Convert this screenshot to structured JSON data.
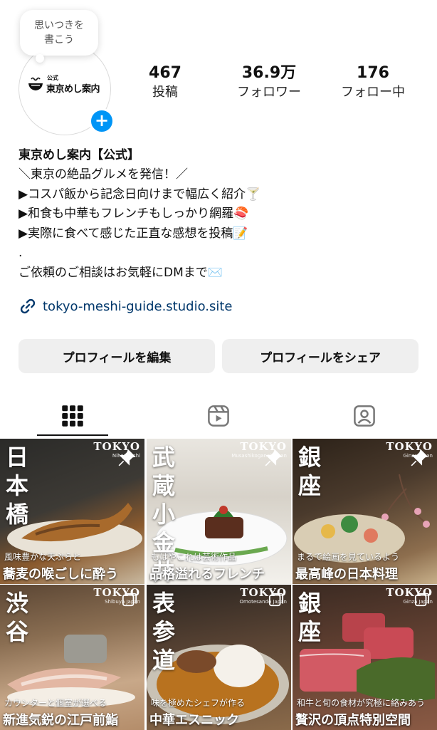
{
  "note": {
    "text": "思いつきを\n書こう"
  },
  "avatar": {
    "logo_small": "公式",
    "logo_name": "東京めし案内"
  },
  "stats": [
    {
      "num": "467",
      "label": "投稿"
    },
    {
      "num": "36.9万",
      "label": "フォロワー"
    },
    {
      "num": "176",
      "label": "フォロー中"
    }
  ],
  "bio": {
    "name": "東京めし案内【公式】",
    "lines": [
      "＼東京の絶品グルメを発信！／",
      "▶コスパ飯から記念日向けまで幅広く紹介🍸",
      "▶和食も中華もフレンチもしっかり網羅🍣",
      "▶実際に食べて感じた正直な感想を投稿📝",
      ".",
      "ご依頼のご相談はお気軽にDMまで✉️"
    ],
    "link": "tokyo-meshi-guide.studio.site"
  },
  "buttons": {
    "edit": "プロフィールを編集",
    "share": "プロフィールをシェア"
  },
  "tabs": [
    "grid-icon",
    "reels-icon",
    "tagged-icon"
  ],
  "colors": {
    "accent": "#0095f6",
    "link": "#00376b",
    "button_bg": "#efefef"
  },
  "posts": [
    {
      "place": "日本橋",
      "tokyo": "TOKYO",
      "tokyo_sub": "Nihonbashi",
      "sub": "風味豊かな天ぷらと",
      "caption": "蕎麦の喉ごしに酔う",
      "badge": "pin"
    },
    {
      "place": "武蔵小金井",
      "tokyo": "TOKYO",
      "tokyo_sub": "Musashikoganei Japan",
      "sub": "もはやこれは芸術作品",
      "caption": "品格溢れるフレンチ",
      "badge": "pin"
    },
    {
      "place": "銀座",
      "tokyo": "TOKYO",
      "tokyo_sub": "Ginza Japan",
      "sub": "まるで絵画を見ているよう",
      "caption": "最高峰の日本料理",
      "badge": "pin"
    },
    {
      "place": "渋谷",
      "tokyo": "TOKYO",
      "tokyo_sub": "Shibuya Japan",
      "sub": "カウンターと個室が選べる",
      "caption": "新進気鋭の江戸前鮨",
      "badge": "multi"
    },
    {
      "place": "表参道",
      "tokyo": "TOKYO",
      "tokyo_sub": "Omotesando Japan",
      "sub": "味を極めたシェフが作る",
      "caption": "中華エスニック",
      "badge": "multi"
    },
    {
      "place": "銀座",
      "tokyo": "TOKYO",
      "tokyo_sub": "Ginza Japan",
      "sub": "和牛と旬の食材が究極に絡みあう",
      "caption": "贅沢の頂点特別空間",
      "badge": "multi"
    }
  ]
}
